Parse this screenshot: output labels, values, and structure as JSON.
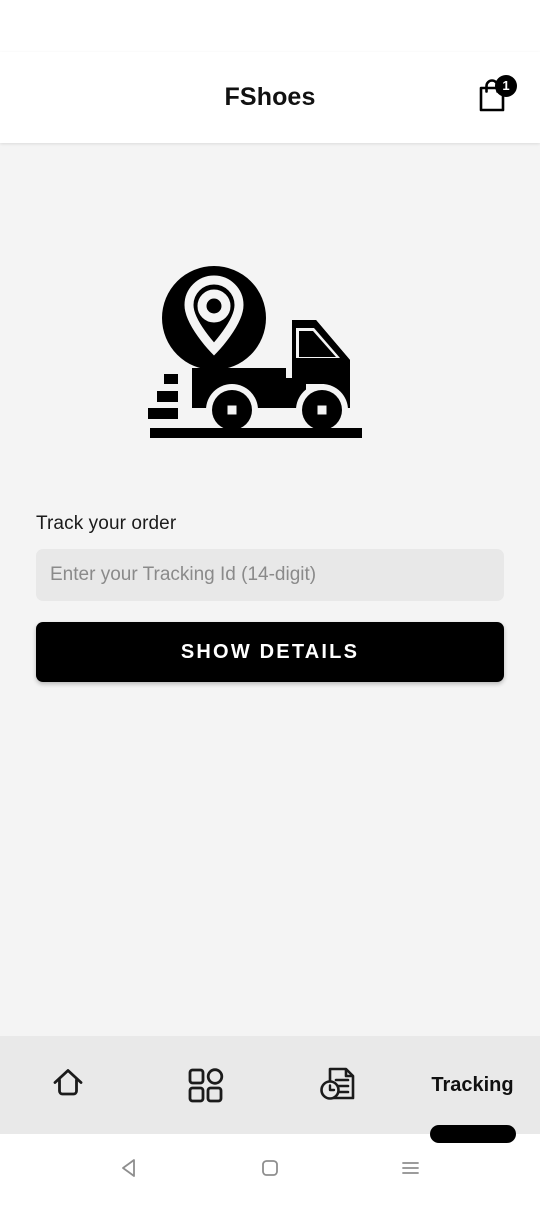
{
  "header": {
    "title": "FShoes",
    "cart_icon": "shopping-bag-icon",
    "cart_badge_count": "1"
  },
  "main": {
    "hero_icon": "delivery-truck-location-icon",
    "form": {
      "label": "Track your order",
      "input_placeholder": "Enter your Tracking Id (14-digit)",
      "input_value": "",
      "submit_label": "SHOW DETAILS"
    }
  },
  "bottom_nav": {
    "items": [
      {
        "label": "",
        "icon": "home-icon",
        "active": false
      },
      {
        "label": "",
        "icon": "grid-categories-icon",
        "active": false
      },
      {
        "label": "",
        "icon": "order-history-document-clock-icon",
        "active": false
      },
      {
        "label": "Tracking",
        "icon": "",
        "active": true
      }
    ]
  },
  "system_nav": {
    "back": "back-triangle-icon",
    "home": "home-square-icon",
    "recents": "recents-menu-icon"
  },
  "colors": {
    "accent": "#000000",
    "page_background": "#f4f4f4",
    "header_background": "#ffffff",
    "nav_background": "#e9e9e9",
    "input_background": "#e8e8e8"
  }
}
